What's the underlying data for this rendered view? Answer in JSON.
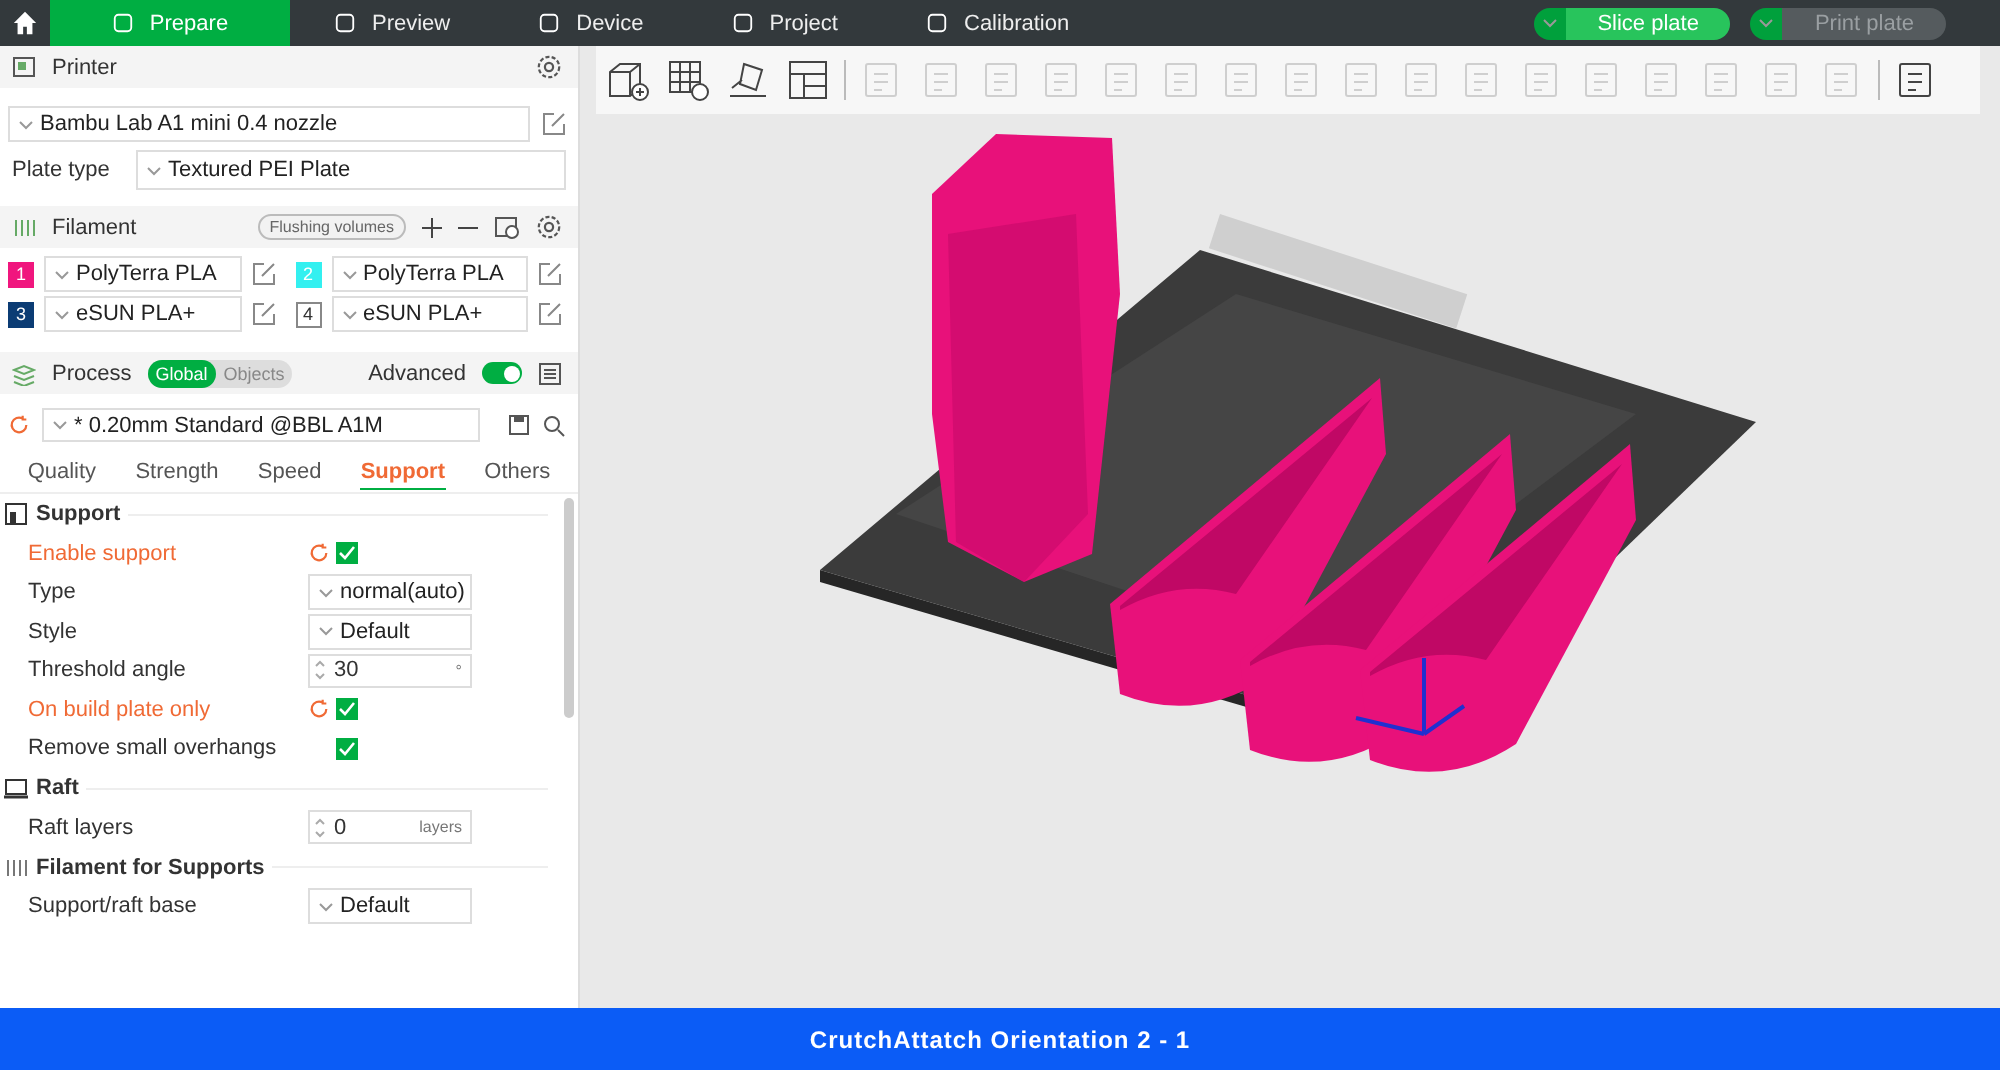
{
  "top_bar": {
    "tabs": [
      {
        "label": "Prepare",
        "selected": true
      },
      {
        "label": "Preview",
        "selected": false
      },
      {
        "label": "Device",
        "selected": false
      },
      {
        "label": "Project",
        "selected": false
      },
      {
        "label": "Calibration",
        "selected": false
      }
    ],
    "actions": [
      {
        "label": "Slice plate",
        "disabled": false
      },
      {
        "label": "Print plate",
        "disabled": true
      }
    ]
  },
  "printer": {
    "title": "Printer",
    "preset": "Bambu Lab A1 mini 0.4 nozzle",
    "plate_label": "Plate type",
    "plate_value": "Textured PEI Plate"
  },
  "filament": {
    "title": "Filament",
    "flushing": "Flushing volumes",
    "items": [
      {
        "number": "1",
        "color": "#f0167e",
        "name": "PolyTerra PLA"
      },
      {
        "number": "2",
        "color": "#33f0f0",
        "name": "PolyTerra PLA"
      },
      {
        "number": "3",
        "color": "#0b3c74",
        "name": "eSUN PLA+"
      },
      {
        "number": "4",
        "color": "#ffffff",
        "name": "eSUN PLA+"
      }
    ]
  },
  "process": {
    "title": "Process",
    "scopes": [
      {
        "label": "Global",
        "selected": true
      },
      {
        "label": "Objects",
        "selected": false
      }
    ],
    "advanced_label": "Advanced",
    "advanced_on": true,
    "preset": "* 0.20mm Standard @BBL A1M",
    "tabs": [
      {
        "label": "Quality",
        "selected": false
      },
      {
        "label": "Strength",
        "selected": false
      },
      {
        "label": "Speed",
        "selected": false
      },
      {
        "label": "Support",
        "selected": true
      },
      {
        "label": "Others",
        "selected": false
      }
    ]
  },
  "settings": [
    {
      "title": "Support",
      "rows": [
        {
          "label": "Enable support",
          "modified": true,
          "kind": "checkbox",
          "checked": true
        },
        {
          "label": "Type",
          "modified": false,
          "kind": "select",
          "value": "normal(auto)"
        },
        {
          "label": "Style",
          "modified": false,
          "kind": "select",
          "value": "Default"
        },
        {
          "label": "Threshold angle",
          "modified": false,
          "kind": "spin",
          "value": "30",
          "unit": "°"
        },
        {
          "label": "On build plate only",
          "modified": true,
          "kind": "checkbox",
          "checked": true
        },
        {
          "label": "Remove small overhangs",
          "modified": false,
          "kind": "checkbox",
          "checked": true
        }
      ]
    },
    {
      "title": "Raft",
      "rows": [
        {
          "label": "Raft layers",
          "modified": false,
          "kind": "spin",
          "value": "0",
          "unit": "layers"
        }
      ]
    },
    {
      "title": "Filament for Supports",
      "rows": [
        {
          "label": "Support/raft base",
          "modified": false,
          "kind": "select",
          "value": "Default"
        }
      ]
    }
  ],
  "toolbar": {
    "tools": [
      {
        "disabled": false
      },
      {
        "disabled": false
      },
      {
        "disabled": false
      },
      {
        "disabled": false
      },
      {
        "disabled": true
      },
      {
        "disabled": true
      },
      {
        "disabled": true
      },
      {
        "disabled": true
      },
      {
        "disabled": true
      },
      {
        "disabled": true
      },
      {
        "disabled": true
      },
      {
        "disabled": true
      },
      {
        "disabled": true
      },
      {
        "disabled": true
      },
      {
        "disabled": true
      },
      {
        "disabled": true
      },
      {
        "disabled": true
      },
      {
        "disabled": true
      },
      {
        "disabled": true
      },
      {
        "disabled": true
      },
      {
        "disabled": true
      },
      {
        "disabled": false
      }
    ]
  },
  "status_bar": {
    "title": "CrutchAttatch Orientation 2 - 1"
  }
}
